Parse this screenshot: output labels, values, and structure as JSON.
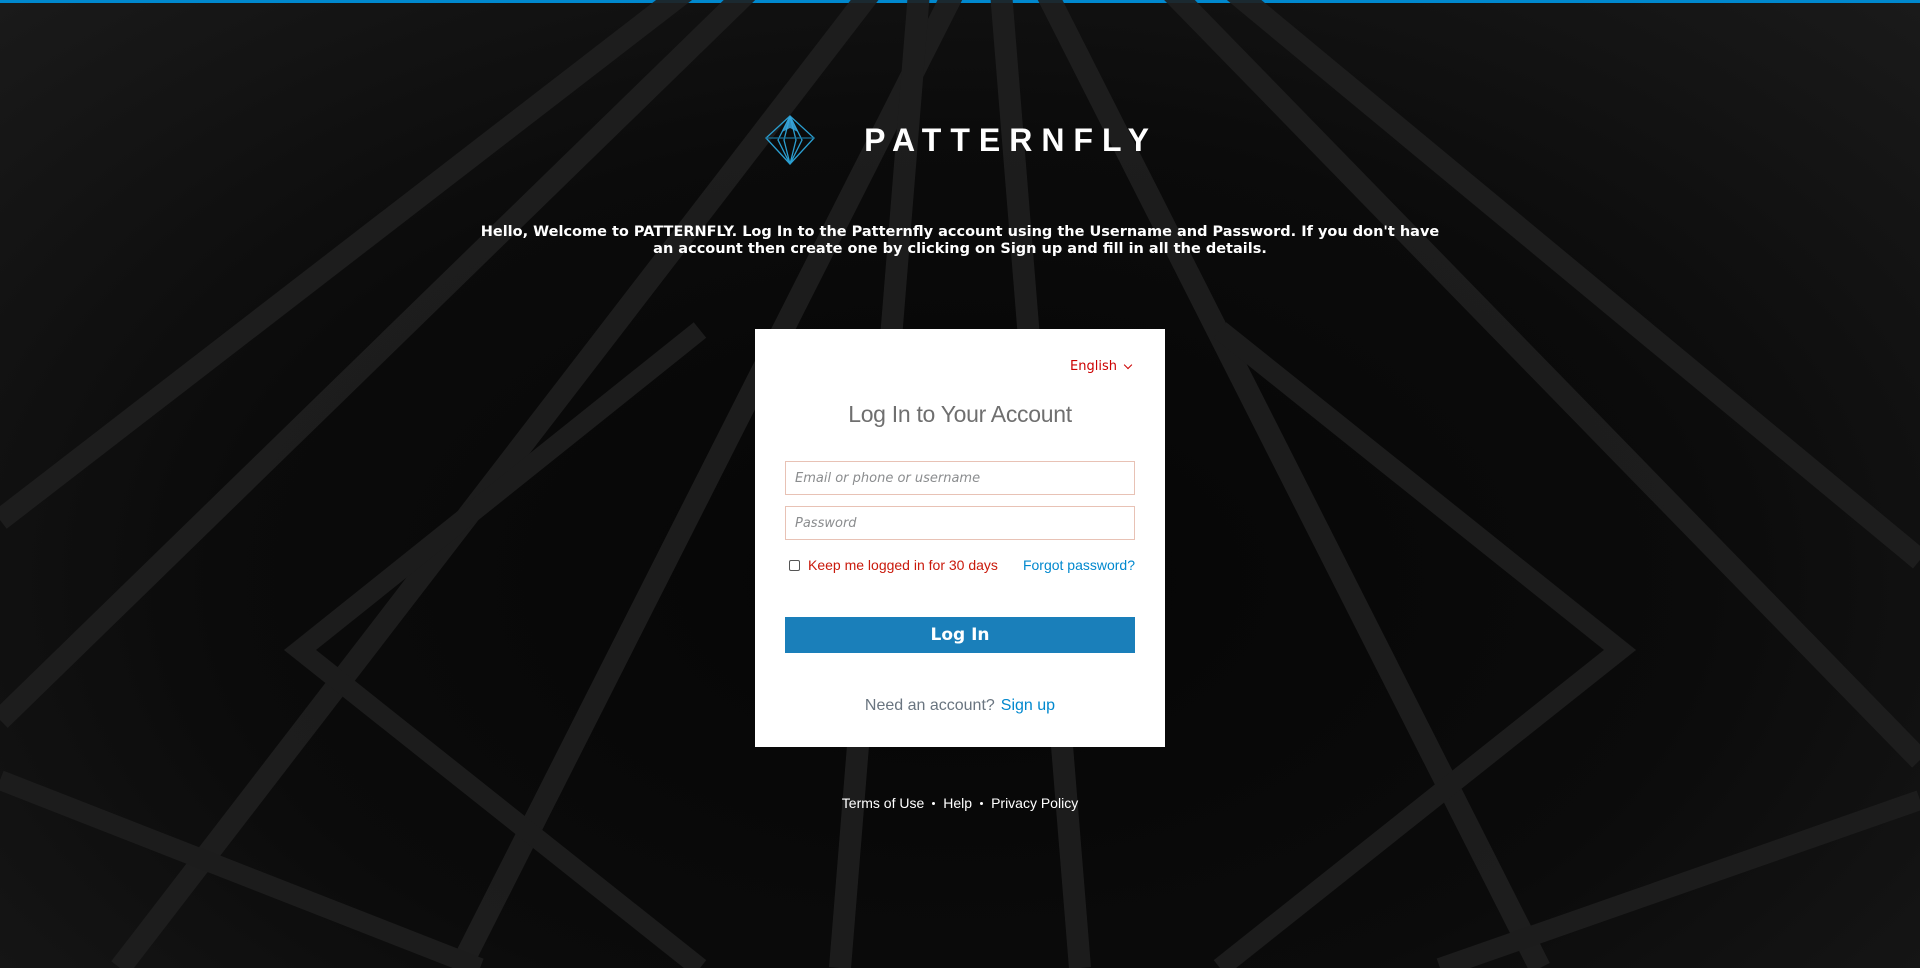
{
  "brand": {
    "logo_icon": "patternfly-logo-icon",
    "name": "PATTERNFLY",
    "accent_color": "#0088ce"
  },
  "welcome": {
    "text": "Hello, Welcome to PATTERNFLY. Log In to the Patternfly account using the Username and Password. If you don't have an account then create one by clicking on Sign up and fill in all the details."
  },
  "login_card": {
    "language": {
      "selected": "English",
      "icon": "chevron-down-icon"
    },
    "title": "Log In to Your Account",
    "username_field": {
      "placeholder": "Email or phone or username",
      "value": ""
    },
    "password_field": {
      "placeholder": "Password",
      "value": ""
    },
    "remember_me": {
      "label": "Keep me logged in for 30 days",
      "checked": false
    },
    "forgot_password": "Forgot password?",
    "submit_label": "Log In",
    "signup_prompt": "Need an account?",
    "signup_link": "Sign up"
  },
  "footer": {
    "links": [
      "Terms of Use",
      "Help",
      "Privacy Policy"
    ]
  }
}
